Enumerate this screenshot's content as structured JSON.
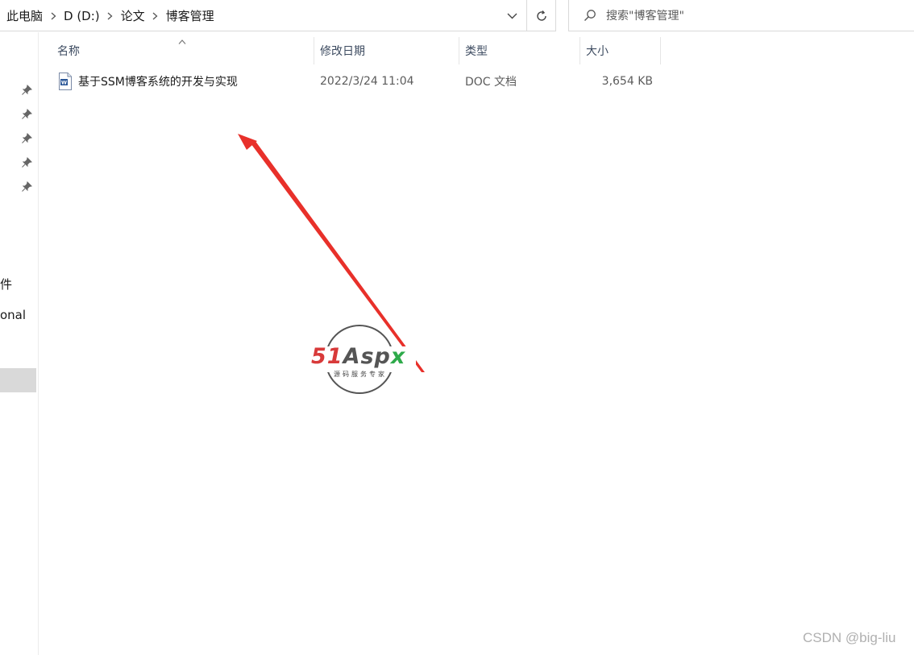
{
  "address": {
    "crumbs": [
      "此电脑",
      "D (D:)",
      "论文",
      "博客管理"
    ]
  },
  "search": {
    "placeholder": "搜索\"博客管理\""
  },
  "navpane": {
    "fragments": [
      "件",
      "onal"
    ],
    "pinned_count": 5
  },
  "columns": {
    "name": "名称",
    "modified": "修改日期",
    "type": "类型",
    "size": "大小",
    "sorted_by": "name",
    "sort_order": "ascending"
  },
  "files": [
    {
      "name": "基于SSM博客系统的开发与实现",
      "modified": "2022/3/24 11:04",
      "type": "DOC 文档",
      "size": "3,654 KB",
      "icon": "word-doc-icon"
    }
  ],
  "overlay": {
    "logo": {
      "part1": "51",
      "part2": "Asp",
      "part3": "x",
      "subtitle": "源码服务专家"
    },
    "watermark": "CSDN @big-liu",
    "arrow_color": "#e8302a"
  }
}
